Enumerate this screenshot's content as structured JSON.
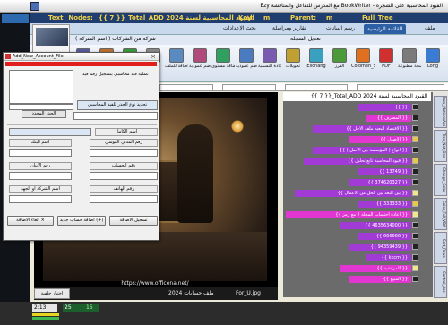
{
  "window": {
    "title": "Ezy مع المدرس للتفاعل والمناقشة BookWriter - القيود المحاسبية على الشجرة"
  },
  "infobar": {
    "text_nodes_label": "Text _Nodes:",
    "text_nodes_value": "{{ 7 }}_Total_ADD 2024 القيود المحاسبية لسنة",
    "key_label": "Key:",
    "key_value": "m",
    "parent_label": "Parent:",
    "parent_value": "m",
    "tree_label": "Full_Tree"
  },
  "ribbon": {
    "tabs": [
      "ملف",
      "القائمة الرئيسية",
      "رسم البيانات",
      "تقارير ومراسلة",
      "بحث الإعدادات"
    ],
    "active_tab_index": 1,
    "sub_label": "تعديل السجلة",
    "company_label": "شركة من الشركات ( اسم الشركة )",
    "buttons": [
      {
        "label": "Long",
        "icon": "arrows-icon",
        "color": "#3a7bd5"
      },
      {
        "label": "نسخة مطبوعة",
        "icon": "printer-icon",
        "color": "#7b7b7b"
      },
      {
        "label": "PDF",
        "icon": "pdf-icon",
        "color": "#d03030"
      },
      {
        "label": "Colomen_Size_Ezy",
        "icon": "columns-icon",
        "color": "#e07020"
      },
      {
        "label": "الفرز",
        "icon": "sort-icon",
        "color": "#4a9a3a"
      },
      {
        "label": "Ellchang",
        "icon": "exchange-icon",
        "color": "#3aa0c0"
      },
      {
        "label": "تحويلات",
        "icon": "transfer-icon",
        "color": "#c0a030"
      },
      {
        "label": "اعادة التسمية",
        "icon": "rename-icon",
        "color": "#7a5ab0"
      },
      {
        "label": "ضم عمودية",
        "icon": "merge-vertical-icon",
        "color": "#4a7ac0"
      },
      {
        "label": "اضافة مستوى",
        "icon": "add-level-icon",
        "color": "#30a060"
      },
      {
        "label": "ضم عمودية",
        "icon": "merge-icon",
        "color": "#b04a7a"
      },
      {
        "label": "اضافة للملف",
        "icon": "add-file-icon",
        "color": "#5a8ac0"
      },
      {
        "label": "File",
        "icon": "file-icon",
        "color": "#8a8a8a"
      },
      {
        "label": "نحو عمودية",
        "icon": "down-icon",
        "color": "#3a9a3a"
      },
      {
        "label": "ضم عمودية",
        "icon": "stack-icon",
        "color": "#c07030"
      },
      {
        "label": "ضم عمودية",
        "icon": "grid-icon",
        "color": "#5a5aa0"
      }
    ]
  },
  "tree": {
    "title": "{{ 7 }}_Total_ADD 2024 القيود المحاسبية لسنة",
    "rows": [
      {
        "text": "{{ }}",
        "bar": "purple",
        "node": "plain"
      },
      {
        "text": "{{ المصرف }}",
        "bar": "pink",
        "node": "plain"
      },
      {
        "text": "{{ الاقتصاد لتبعيه ملف الاجل }}",
        "bar": "purple",
        "node": "plain"
      },
      {
        "text": "{{ الاصول }}",
        "bar": "pink",
        "node": "key"
      },
      {
        "text": "{{ انواع ( المؤسسة بين الاصل ) }}",
        "bar": "purple",
        "node": "plain"
      },
      {
        "text": "{{ قيود المحاسبة تابع تحليل }}",
        "bar": "purple",
        "node": "key"
      },
      {
        "text": "{{ 13749 }}",
        "bar": "purple",
        "node": "plain"
      },
      {
        "text": "{{ 374620327 }}",
        "bar": "purple",
        "node": "plain"
      },
      {
        "text": "{{ بين البعد بين الحل من الاعمال }}",
        "bar": "purple",
        "node": "q"
      },
      {
        "text": "{{ 333333 }}",
        "bar": "purple",
        "node": "key"
      },
      {
        "text": "{{ اعادة احتساب المجلة لا مع رمز }}",
        "bar": "pink",
        "node": "q"
      },
      {
        "text": "{{ 4635634000 }}",
        "bar": "purple",
        "node": "plain"
      },
      {
        "text": "{{ 666666 }}",
        "bar": "purple",
        "node": "plain"
      },
      {
        "text": "{{ 94359439 }}",
        "bar": "purple",
        "node": "plain"
      },
      {
        "text": "{{ kkcm }}",
        "bar": "purple",
        "node": "plain"
      },
      {
        "text": "{{ المرتشيه }}",
        "bar": "pink",
        "node": "q"
      },
      {
        "text": "{{ المبيع }}",
        "bar": "pink",
        "node": "plain"
      }
    ],
    "side_tabs": [
      "Row_MotionsAds",
      "Tree_Not_One",
      "Change_Color",
      "Color_Full_VBA",
      "Sort_Rows",
      "Control_Acc"
    ]
  },
  "main": {
    "url": "https://www.officena.net/",
    "footer_year_label": "ملف حسابات 2024",
    "footer_file": "For_U.jpg",
    "footer_button": "اختيار خلفية"
  },
  "status": {
    "time": "2:13",
    "count": "25",
    "count2": "15"
  },
  "dialog": {
    "title": "Add_New_Account_File",
    "hint": "عملية قيد محاسبي يتسجيل رقم قيد",
    "type_label": "تحديد نوع الجذر للقيد المحاسبي",
    "save_gray_label": "الجذر المحدد",
    "full_name_label": "اسم الكامل",
    "civil_id_label": "رقم المدني القوسي",
    "bank_name_label": "اسم البنك",
    "account_no_label": "رقم الحساب",
    "iban_label": "رقم الايبان",
    "phone_label": "رقم الهاتف",
    "company_name_label": "اسم الشركة او الجهة",
    "btn_add_new": "تسجيل الاضافة",
    "btn_add_account": "اضافة حساب جديد (+)",
    "btn_cancel": "الغاء الاضافة ×"
  }
}
